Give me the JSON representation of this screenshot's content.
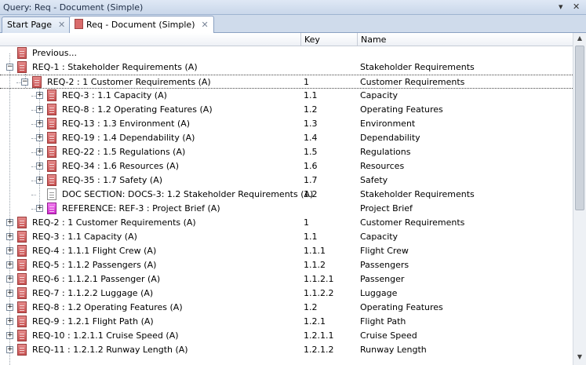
{
  "window": {
    "title": "Query: Req - Document (Simple)",
    "minimize_glyph": "▾",
    "close_glyph": "✕"
  },
  "tabs": [
    {
      "label": "Start Page",
      "close": "✕"
    },
    {
      "label": "Req - Document (Simple)",
      "close": "✕"
    }
  ],
  "columns": {
    "key": "Key",
    "name": "Name"
  },
  "rows": [
    {
      "label": "Previous...",
      "key": "",
      "name": ""
    },
    {
      "label": "REQ-1 : Stakeholder Requirements (A)",
      "key": "",
      "name": "Stakeholder Requirements"
    },
    {
      "label": "REQ-2 : 1 Customer Requirements (A)",
      "key": "1",
      "name": "Customer Requirements"
    },
    {
      "label": "REQ-3 : 1.1 Capacity (A)",
      "key": "1.1",
      "name": "Capacity"
    },
    {
      "label": "REQ-8 : 1.2 Operating Features (A)",
      "key": "1.2",
      "name": "Operating Features"
    },
    {
      "label": "REQ-13 : 1.3 Environment (A)",
      "key": "1.3",
      "name": "Environment"
    },
    {
      "label": "REQ-19 : 1.4 Dependability (A)",
      "key": "1.4",
      "name": "Dependability"
    },
    {
      "label": "REQ-22 : 1.5 Regulations (A)",
      "key": "1.5",
      "name": "Regulations"
    },
    {
      "label": "REQ-34 : 1.6 Resources (A)",
      "key": "1.6",
      "name": "Resources"
    },
    {
      "label": "REQ-35 : 1.7 Safety (A)",
      "key": "1.7",
      "name": "Safety"
    },
    {
      "label": "DOC SECTION: DOCS-3:   1.2 Stakeholder Requirements (A)",
      "key": "1.2",
      "name": "Stakeholder Requirements"
    },
    {
      "label": "REFERENCE: REF-3 : Project Brief (A)",
      "key": "",
      "name": "Project Brief"
    },
    {
      "label": "REQ-2 : 1 Customer Requirements (A)",
      "key": "1",
      "name": "Customer Requirements"
    },
    {
      "label": "REQ-3 : 1.1 Capacity (A)",
      "key": "1.1",
      "name": "Capacity"
    },
    {
      "label": "REQ-4 : 1.1.1 Flight Crew (A)",
      "key": "1.1.1",
      "name": "Flight Crew"
    },
    {
      "label": "REQ-5 : 1.1.2 Passengers (A)",
      "key": "1.1.2",
      "name": "Passengers"
    },
    {
      "label": "REQ-6 : 1.1.2.1 Passenger (A)",
      "key": "1.1.2.1",
      "name": "Passenger"
    },
    {
      "label": "REQ-7 : 1.1.2.2 Luggage (A)",
      "key": "1.1.2.2",
      "name": "Luggage"
    },
    {
      "label": "REQ-8 : 1.2 Operating Features (A)",
      "key": "1.2",
      "name": "Operating Features"
    },
    {
      "label": "REQ-9 : 1.2.1 Flight Path (A)",
      "key": "1.2.1",
      "name": "Flight Path"
    },
    {
      "label": "REQ-10 : 1.2.1.1 Cruise Speed (A)",
      "key": "1.2.1.1",
      "name": "Cruise Speed"
    },
    {
      "label": "REQ-11 : 1.2.1.2 Runway Length (A)",
      "key": "1.2.1.2",
      "name": "Runway Length"
    }
  ],
  "scrollbar": {
    "up": "▲",
    "down": "▼"
  }
}
